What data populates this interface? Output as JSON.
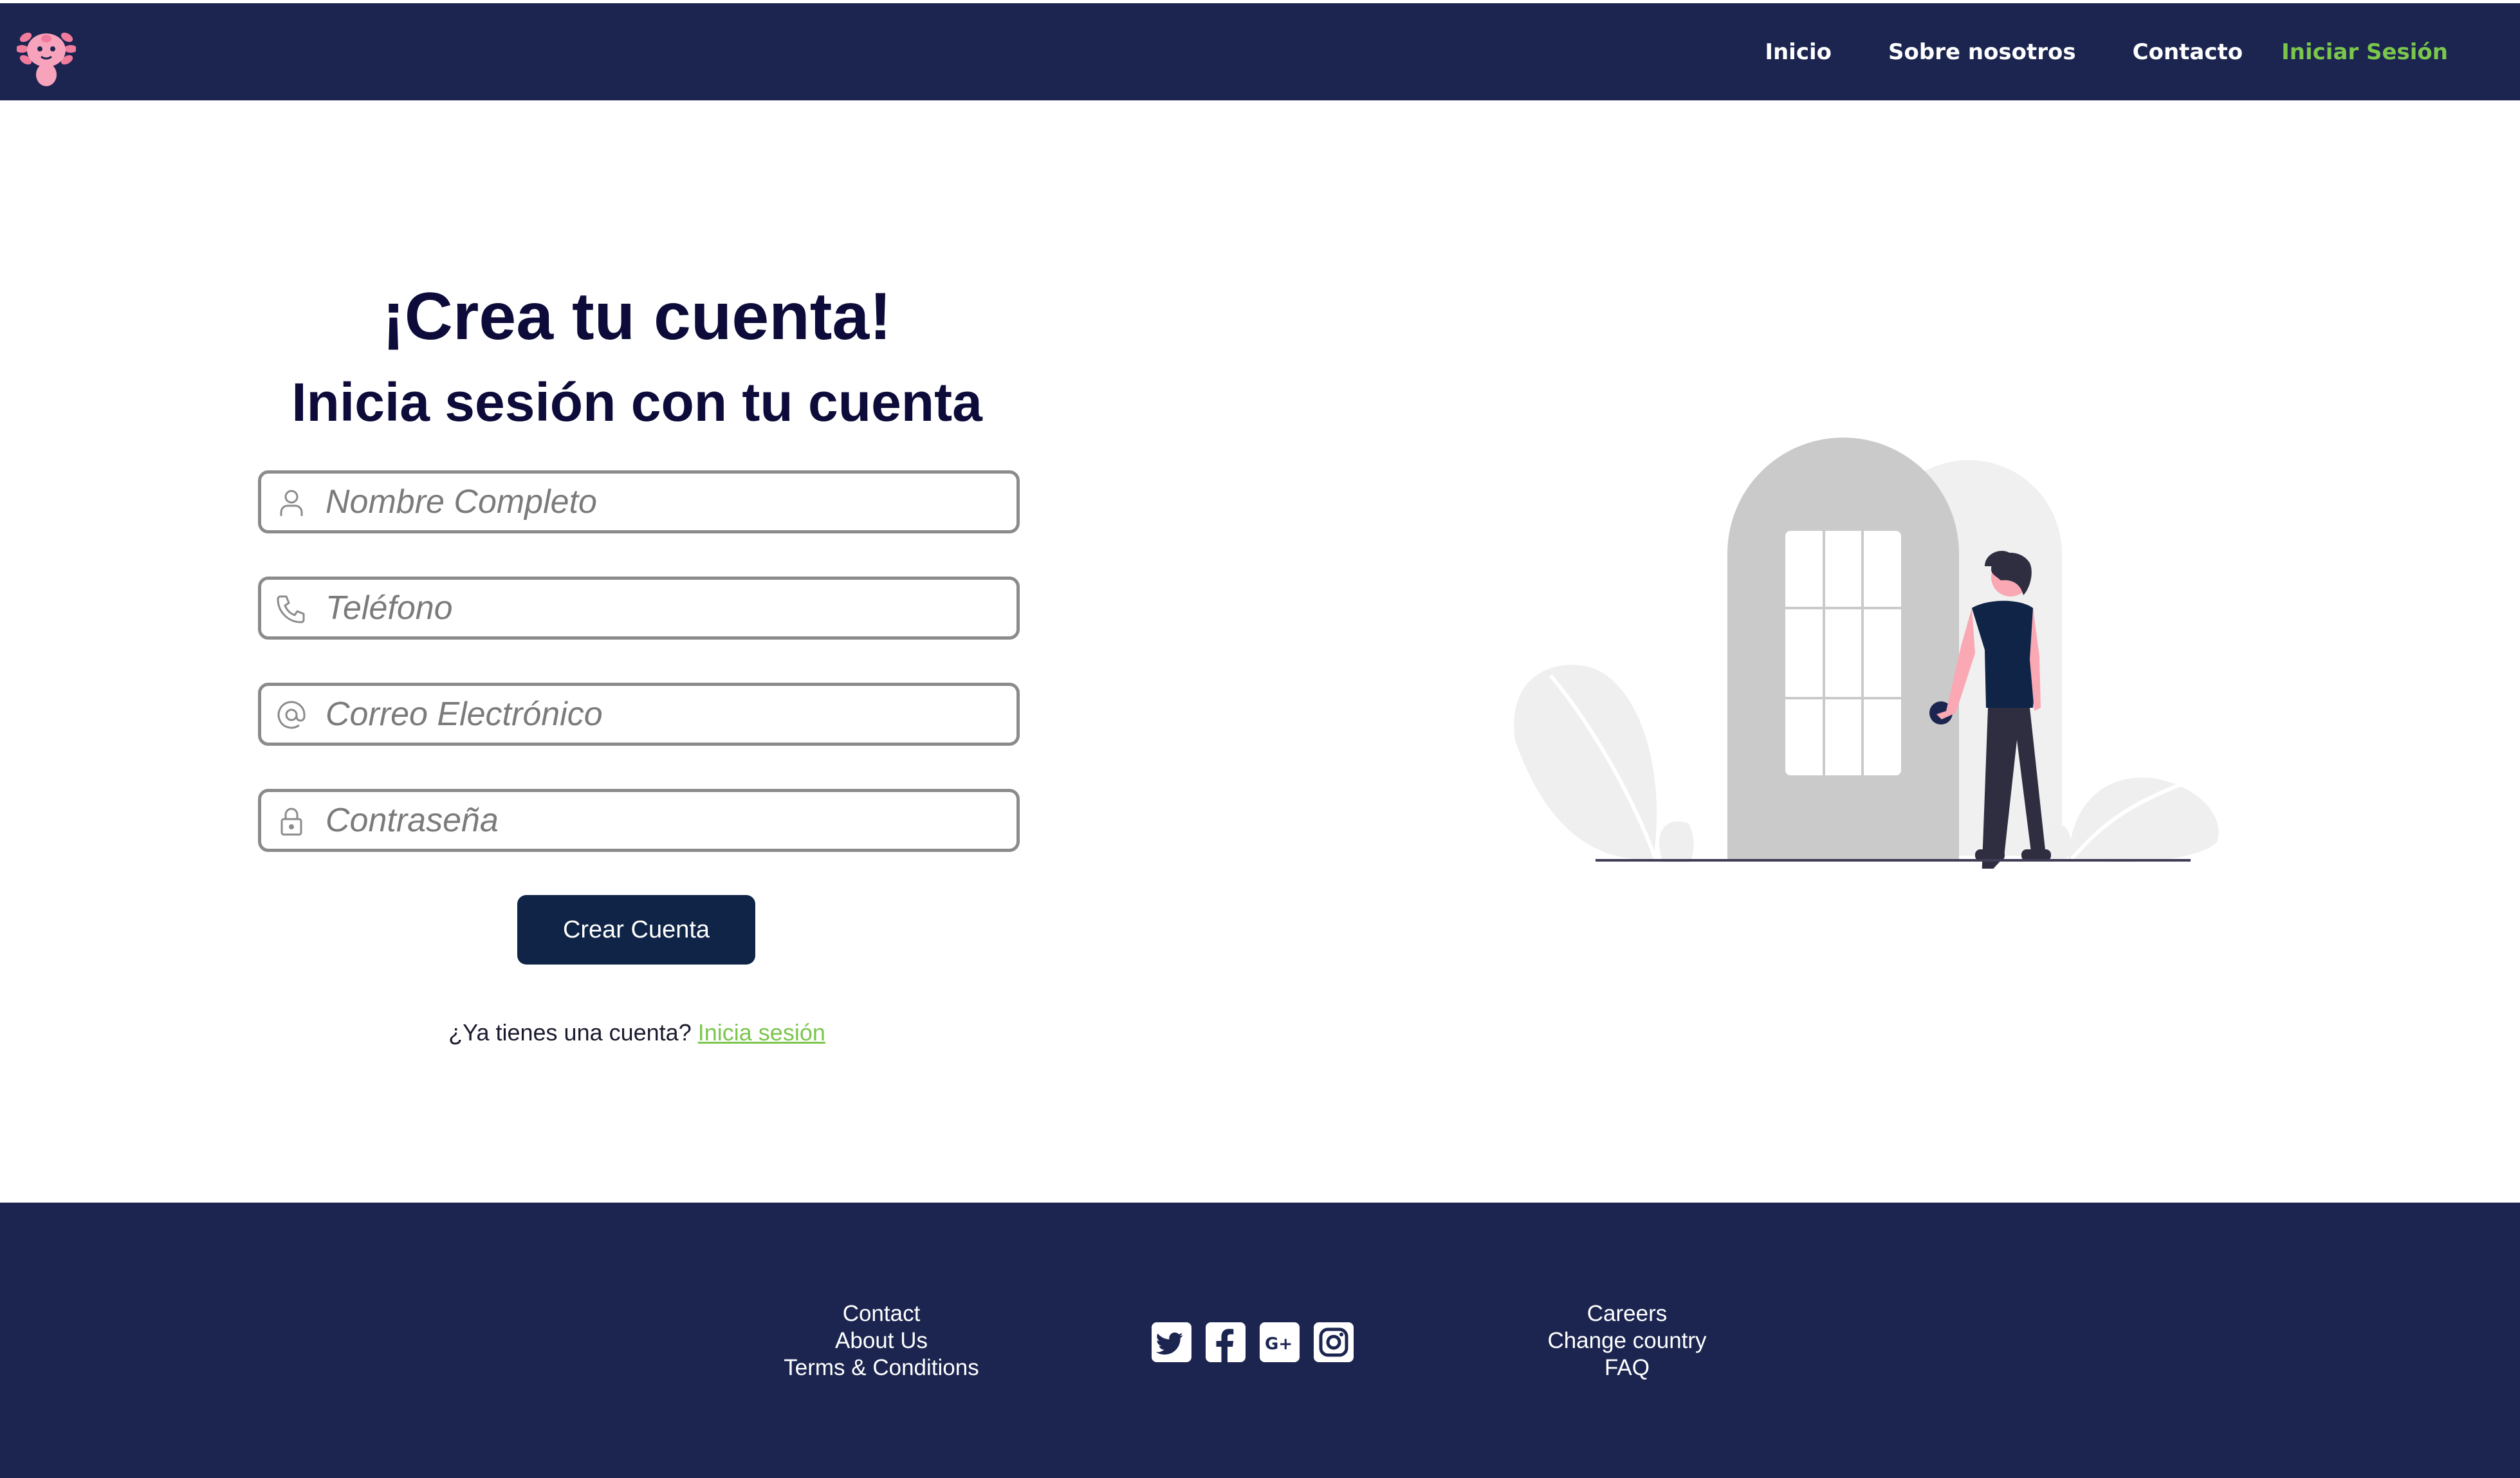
{
  "nav": {
    "logo_alt": "axolotl-logo",
    "links": [
      "Inicio",
      "Sobre nosotros",
      "Contacto"
    ],
    "active_link": "Iniciar Sesión"
  },
  "form": {
    "title": "¡Crea tu cuenta!",
    "subtitle": "Inicia sesión con tu cuenta",
    "fields": [
      {
        "placeholder": "Nombre Completo",
        "icon": "user-icon",
        "value": ""
      },
      {
        "placeholder": "Teléfono",
        "icon": "phone-icon",
        "value": ""
      },
      {
        "placeholder": "Correo Electrónico",
        "icon": "at-icon",
        "value": ""
      },
      {
        "placeholder": "Contraseña",
        "icon": "lock-icon",
        "value": ""
      }
    ],
    "submit_label": "Crear Cuenta",
    "login_prompt": "¿Ya tienes una cuenta?",
    "login_link": "Inicia sesión"
  },
  "illustration": {
    "icon": "person-at-door-illustration"
  },
  "footer": {
    "left_links": [
      "Contact",
      "About Us",
      "Terms & Conditions"
    ],
    "socials": [
      "twitter-icon",
      "facebook-icon",
      "google-plus-icon",
      "instagram-icon"
    ],
    "right_links": [
      "Careers",
      "Change country",
      "FAQ"
    ]
  },
  "colors": {
    "navy": "#1b2550",
    "button": "#0f2447",
    "accent_green": "#7bc64c",
    "heading": "#0d0b3a"
  }
}
